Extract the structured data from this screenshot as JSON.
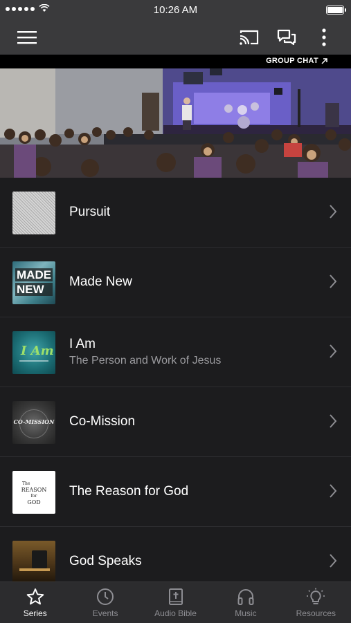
{
  "status_bar": {
    "time": "10:26 AM"
  },
  "hero": {
    "group_chat_label": "GROUP CHAT"
  },
  "series": [
    {
      "title": "Pursuit",
      "subtitle": "",
      "thumb": "pursuit"
    },
    {
      "title": "Made New",
      "subtitle": "",
      "thumb": "made-new",
      "thumb_text": [
        "MADE",
        "NEW"
      ]
    },
    {
      "title": "I Am",
      "subtitle": "The Person and Work of Jesus",
      "thumb": "i-am",
      "thumb_text": [
        "I Am"
      ]
    },
    {
      "title": "Co-Mission",
      "subtitle": "",
      "thumb": "co-mission",
      "thumb_text": [
        "CO-MISSION"
      ]
    },
    {
      "title": "The Reason for God",
      "subtitle": "",
      "thumb": "reason",
      "thumb_text": [
        "The",
        "REASON",
        "for",
        "GOD"
      ]
    },
    {
      "title": "God Speaks",
      "subtitle": "",
      "thumb": "god-speaks"
    }
  ],
  "tabs": [
    {
      "label": "Series",
      "icon": "star-icon",
      "active": true
    },
    {
      "label": "Events",
      "icon": "clock-icon",
      "active": false
    },
    {
      "label": "Audio Bible",
      "icon": "bible-icon",
      "active": false
    },
    {
      "label": "Music",
      "icon": "headphones-icon",
      "active": false
    },
    {
      "label": "Resources",
      "icon": "lightbulb-icon",
      "active": false
    }
  ]
}
